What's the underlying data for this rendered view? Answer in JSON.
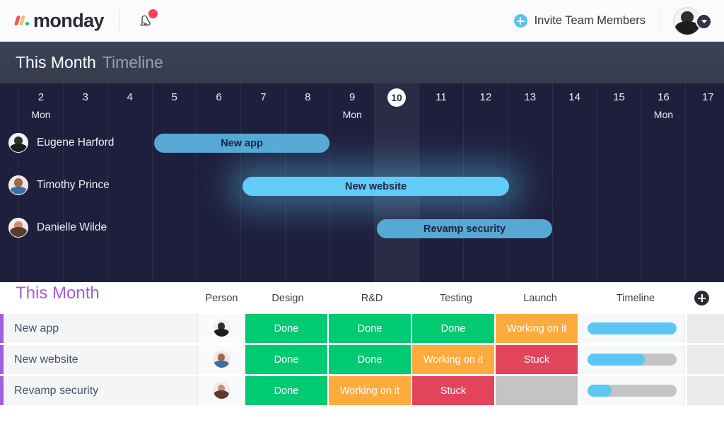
{
  "topbar": {
    "logo_text": "monday",
    "logo_icon": "monday-logo-icon",
    "bell_icon": "notification-bell-icon",
    "invite_label": "Invite Team Members",
    "invite_icon": "plus-circle-icon",
    "avatar_name": "user-avatar",
    "chevron_icon": "chevron-down-icon"
  },
  "timeline_header": {
    "title": "This Month",
    "subtitle": "Timeline"
  },
  "gantt": {
    "today": "10",
    "columns": [
      {
        "num": "2",
        "day": "Mon",
        "today": false
      },
      {
        "num": "3",
        "day": "",
        "today": false
      },
      {
        "num": "4",
        "day": "",
        "today": false
      },
      {
        "num": "5",
        "day": "",
        "today": false
      },
      {
        "num": "6",
        "day": "",
        "today": false
      },
      {
        "num": "7",
        "day": "",
        "today": false
      },
      {
        "num": "8",
        "day": "",
        "today": false
      },
      {
        "num": "9",
        "day": "Mon",
        "today": false
      },
      {
        "num": "10",
        "day": "",
        "today": true
      },
      {
        "num": "11",
        "day": "",
        "today": false
      },
      {
        "num": "12",
        "day": "",
        "today": false
      },
      {
        "num": "13",
        "day": "",
        "today": false
      },
      {
        "num": "14",
        "day": "",
        "today": false
      },
      {
        "num": "15",
        "day": "",
        "today": false
      },
      {
        "num": "16",
        "day": "Mon",
        "today": false
      },
      {
        "num": "17",
        "day": "",
        "today": false
      }
    ],
    "rows": [
      {
        "person": "Eugene Harford",
        "task": "New app",
        "highlight": false
      },
      {
        "person": "Timothy Prince",
        "task": "New website",
        "highlight": true
      },
      {
        "person": "Danielle Wilde",
        "task": "Revamp security",
        "highlight": false
      }
    ]
  },
  "board": {
    "title": "This Month",
    "add_column_icon": "add-column-icon",
    "columns": [
      "Person",
      "Design",
      "R&D",
      "Testing",
      "Launch",
      "Timeline"
    ],
    "rows": [
      {
        "name": "New app",
        "design": "Done",
        "rnd": "Done",
        "testing": "Done",
        "launch": "Working on it",
        "progress": 100
      },
      {
        "name": "New website",
        "design": "Done",
        "rnd": "Done",
        "testing": "Working on it",
        "launch": "Stuck",
        "progress": 65
      },
      {
        "name": "Revamp security",
        "design": "Done",
        "rnd": "Working on it",
        "testing": "Stuck",
        "launch": "",
        "progress": 27
      }
    ]
  },
  "colors": {
    "done": "#00ca72",
    "working_on_it": "#fdab3d",
    "stuck": "#e2445c",
    "empty": "#c4c4c4",
    "accent_purple": "#a25ddc",
    "progress_blue": "#5ec6f5",
    "bar_dim": "#56a9d4",
    "bar_bright": "#62ccf8",
    "gantt_bg": "#1e1f3d",
    "header_bg": "#3b4356"
  }
}
